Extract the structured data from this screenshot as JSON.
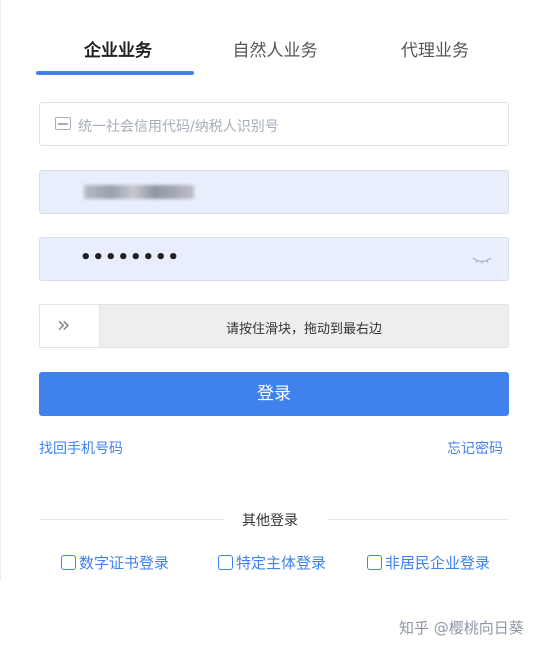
{
  "tabs": [
    {
      "label": "企业业务",
      "active": true
    },
    {
      "label": "自然人业务",
      "active": false
    },
    {
      "label": "代理业务",
      "active": false
    }
  ],
  "credit_code_field": {
    "placeholder": "统一社会信用代码/纳税人识别号",
    "icon": "id-card-icon"
  },
  "username_field": {
    "value_obscured": true
  },
  "password_field": {
    "value": "••••••••",
    "icon": "eye-closed-icon"
  },
  "slider_captcha": {
    "handle_glyph": "»",
    "text": "请按住滑块，拖动到最右边"
  },
  "login_button": {
    "label": "登录"
  },
  "links": {
    "recover_phone": "找回手机号码",
    "forgot_password": "忘记密码"
  },
  "other_login": {
    "title": "其他登录",
    "options": [
      {
        "label": "数字证书登录",
        "icon": "certificate-icon"
      },
      {
        "label": "特定主体登录",
        "icon": "badge-icon"
      },
      {
        "label": "非居民企业登录",
        "icon": "enterprise-icon"
      }
    ]
  },
  "watermark": "知乎 @樱桃向日葵",
  "colors": {
    "accent": "#3f82ee",
    "filled_field": "#e8eefc"
  }
}
